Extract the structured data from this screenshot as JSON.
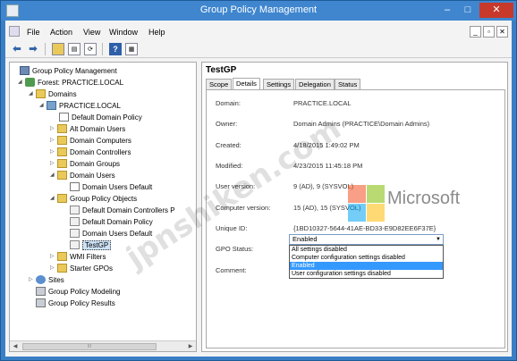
{
  "window": {
    "title": "Group Policy Management",
    "controls": {
      "minimize": "–",
      "maximize": "□",
      "close": "✕"
    }
  },
  "menubar": {
    "items": [
      "File",
      "Action",
      "View",
      "Window",
      "Help"
    ],
    "mdi_controls": [
      "_",
      "▫",
      "✕"
    ]
  },
  "tree": {
    "items": [
      {
        "label": "Group Policy Management",
        "icon": "gpm-icon"
      },
      {
        "label": "Forest: PRACTICE.LOCAL",
        "icon": "forest-icon"
      },
      {
        "label": "Domains",
        "icon": "folder-icon"
      },
      {
        "label": "PRACTICE.LOCAL",
        "icon": "domain-icon"
      },
      {
        "label": "Default Domain Policy",
        "icon": "gpo-link-icon"
      },
      {
        "label": "Alt Domain Users",
        "icon": "folder-icon"
      },
      {
        "label": "Domain Computers",
        "icon": "folder-icon"
      },
      {
        "label": "Domain Controllers",
        "icon": "folder-icon"
      },
      {
        "label": "Domain Groups",
        "icon": "folder-icon"
      },
      {
        "label": "Domain Users",
        "icon": "folder-icon"
      },
      {
        "label": "Domain Users Default",
        "icon": "gpo-link-icon"
      },
      {
        "label": "Group Policy Objects",
        "icon": "folder-icon"
      },
      {
        "label": "Default Domain Controllers P",
        "icon": "gpo-icon"
      },
      {
        "label": "Default Domain Policy",
        "icon": "gpo-icon"
      },
      {
        "label": "Domain Users Default",
        "icon": "gpo-icon"
      },
      {
        "label": "TestGP",
        "icon": "gpo-icon"
      },
      {
        "label": "WMI Filters",
        "icon": "folder-icon"
      },
      {
        "label": "Starter GPOs",
        "icon": "folder-icon"
      },
      {
        "label": "Sites",
        "icon": "sites-icon"
      },
      {
        "label": "Group Policy Modeling",
        "icon": "modeling-icon"
      },
      {
        "label": "Group Policy Results",
        "icon": "results-icon"
      }
    ],
    "selected": "TestGP",
    "scrollbar_label": "III"
  },
  "details": {
    "gpo_name": "TestGP",
    "tabs": [
      "Scope",
      "Details",
      "Settings",
      "Delegation",
      "Status"
    ],
    "active_tab": "Details",
    "fields": [
      {
        "label": "Domain:",
        "value": "PRACTICE.LOCAL"
      },
      {
        "label": "Owner:",
        "value": "Domain Admins (PRACTICE\\Domain Admins)"
      },
      {
        "label": "Created:",
        "value": "4/18/2015 1:49:02 PM"
      },
      {
        "label": "Modified:",
        "value": "4/23/2015 11:45:18 PM"
      },
      {
        "label": "User version:",
        "value": "9 (AD), 9 (SYSVOL)"
      },
      {
        "label": "Computer version:",
        "value": "15 (AD), 15 (SYSVOL)"
      },
      {
        "label": "Unique ID:",
        "value": "{1BD10327-5644-41AE-BD33-E9D82EE6F37E}"
      }
    ],
    "gpo_status": {
      "label": "GPO Status:",
      "value": "Enabled",
      "options": [
        "All settings disabled",
        "Computer configuration settings disabled",
        "Enabled",
        "User configuration settings disabled"
      ],
      "highlighted": "Enabled"
    },
    "comment_label": "Comment:"
  },
  "overlay": {
    "watermark_text": "jpnshiken.com",
    "brand_text": "Microsoft",
    "logo_colors": [
      "#f25022",
      "#7fba00",
      "#00a4ef",
      "#ffb900"
    ]
  }
}
